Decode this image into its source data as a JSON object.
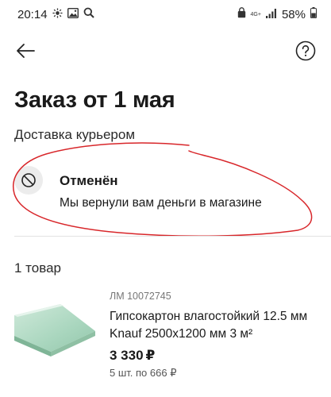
{
  "status_bar": {
    "time": "20:14",
    "network": "4G+",
    "battery": "58%",
    "icons": [
      "sun-icon",
      "image-icon",
      "search-icon",
      "lock-icon",
      "signal-icon",
      "battery-icon"
    ]
  },
  "header": {
    "back_icon": "arrow-left-icon",
    "help_icon": "question-circle-icon"
  },
  "order": {
    "title": "Заказ от 1 мая",
    "delivery": "Доставка курьером",
    "status": {
      "icon": "ban-icon",
      "title": "Отменён",
      "text": "Мы вернули вам деньги в магазине"
    }
  },
  "items": {
    "count_label": "1 товар",
    "list": [
      {
        "sku": "ЛМ 10072745",
        "name": "Гипсокартон влагостойкий 12.5 мм Knauf 2500x1200 мм 3 м²",
        "price": "3 330",
        "currency": "₽",
        "quantity": "5 шт. по 666 ₽"
      }
    ]
  },
  "colors": {
    "scribble": "#d8262a",
    "status_icon_bg": "#ececec",
    "product_image": "#a9d6be"
  }
}
